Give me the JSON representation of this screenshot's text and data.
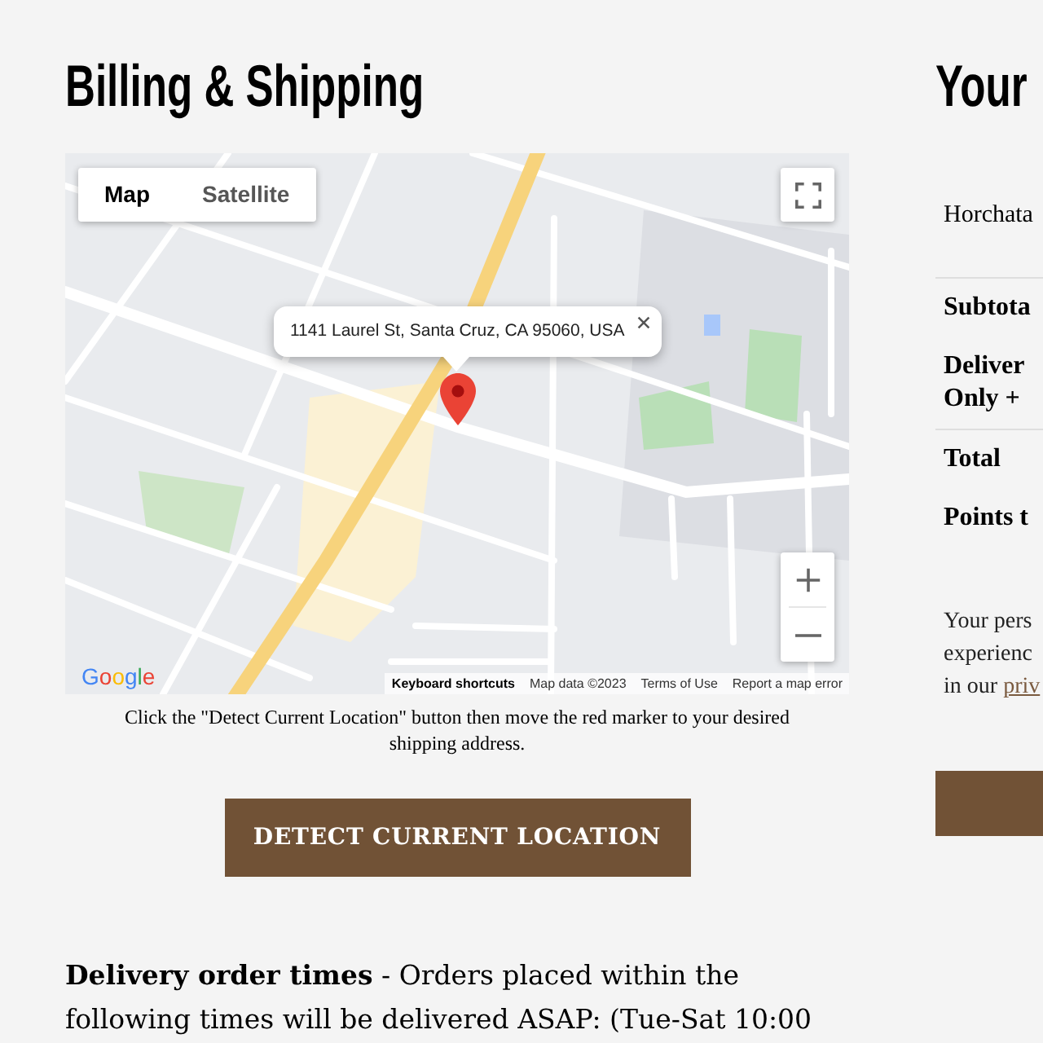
{
  "billing": {
    "heading": "Billing & Shipping",
    "map": {
      "map_type_tabs": [
        {
          "label": "Map",
          "selected": true
        },
        {
          "label": "Satellite",
          "selected": false
        }
      ],
      "info_window": {
        "address": "1141 Laurel St, Santa Cruz, CA 95060, USA"
      },
      "logo": "Google",
      "attribution": [
        {
          "kind": "button",
          "text": "Keyboard shortcuts"
        },
        {
          "kind": "text",
          "text": "Map data ©2023"
        },
        {
          "kind": "link",
          "text": "Terms of Use"
        },
        {
          "kind": "link",
          "text": "Report a map error"
        }
      ]
    },
    "map_hint": "Click the \"Detect Current Location\" button then move the red marker to your desired shipping address.",
    "detect_button": "DETECT CURRENT LOCATION",
    "delivery_note": "**Delivery order times** - Orders placed within the following times will be delivered ASAP: (Tue-Sat 10:00"
  },
  "order_summary": {
    "heading": "Your",
    "sections": [
      {
        "rows": [
          {
            "kind": "item",
            "lines": [
              "Horchata"
            ]
          }
        ]
      },
      {
        "rows": [
          {
            "kind": "summary",
            "lines": [
              "Subtota"
            ]
          },
          {
            "kind": "summary",
            "lines": [
              "Deliver",
              "Only +"
            ]
          }
        ]
      },
      {
        "rows": [
          {
            "kind": "summary",
            "lines": [
              "Total"
            ]
          },
          {
            "kind": "summary",
            "lines": [
              "Points t"
            ]
          }
        ]
      }
    ],
    "note": {
      "lines": [
        "Your pers",
        "experienc",
        "in our"
      ],
      "link": "priv"
    }
  }
}
